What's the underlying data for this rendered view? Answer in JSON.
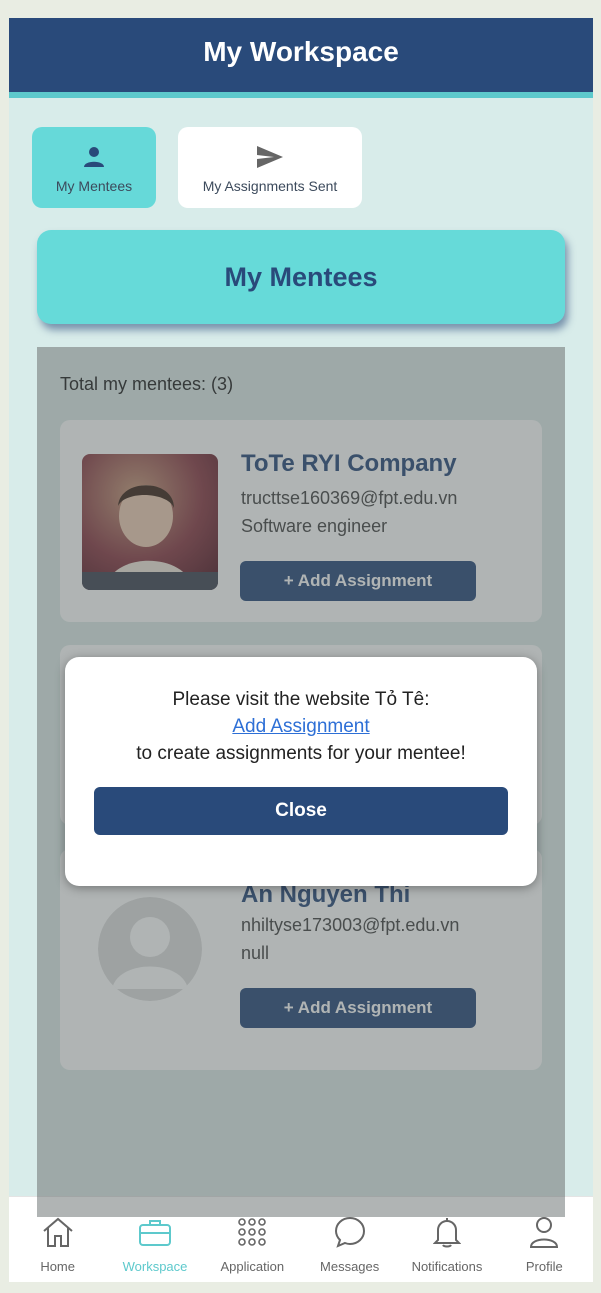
{
  "header": {
    "title": "My Workspace"
  },
  "tabs": [
    {
      "label": "My Mentees",
      "icon": "person-icon"
    },
    {
      "label": "My Assignments Sent",
      "icon": "send-icon"
    }
  ],
  "section": {
    "title": "My Mentees"
  },
  "mentees": {
    "total_label": "Total my mentees: (3)",
    "items": [
      {
        "name": "ToTe RYI Company",
        "email": "tructtse160369@fpt.edu.vn",
        "role": "Software engineer",
        "button": "+ Add Assignment"
      },
      {
        "name": "",
        "email": "",
        "role": "",
        "button": "+ Add Assignment"
      },
      {
        "name": "An Nguyen Thi",
        "email": "nhiltyse173003@fpt.edu.vn",
        "role": "null",
        "button": "+ Add Assignment"
      }
    ]
  },
  "modal": {
    "line1": "Please visit the website Tỏ Tê:",
    "link": "Add Assignment",
    "line3": "to create assignments for your mentee!",
    "close": "Close"
  },
  "nav": [
    {
      "label": "Home",
      "icon": "home-icon"
    },
    {
      "label": "Workspace",
      "icon": "briefcase-icon"
    },
    {
      "label": "Application",
      "icon": "grid-icon"
    },
    {
      "label": "Messages",
      "icon": "chat-icon"
    },
    {
      "label": "Notifications",
      "icon": "bell-icon"
    },
    {
      "label": "Profile",
      "icon": "user-icon"
    }
  ],
  "colors": {
    "primary": "#294a7a",
    "accent": "#66d9d9",
    "link": "#2d6fd6"
  }
}
